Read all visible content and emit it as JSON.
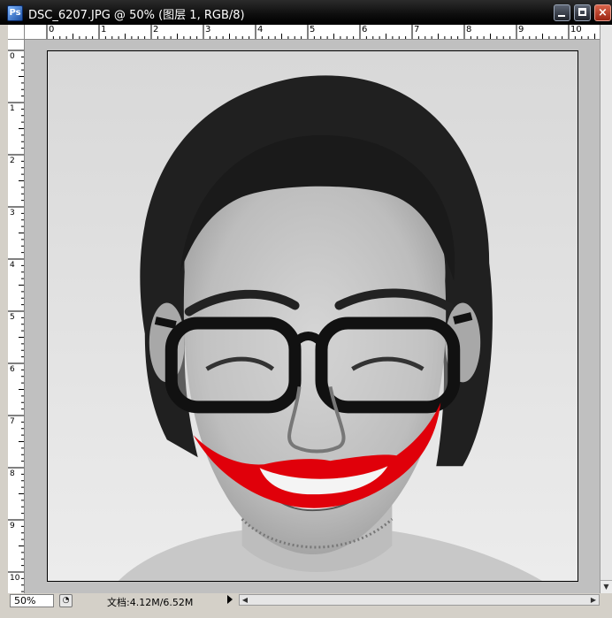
{
  "window": {
    "title": "DSC_6207.JPG @ 50% (图层 1, RGB/8)",
    "controls": {
      "minimize": "minimize",
      "maximize": "maximize",
      "close": "×"
    }
  },
  "rulers": {
    "horizontal_labels": [
      "0",
      "1",
      "2",
      "3",
      "4",
      "5",
      "6",
      "7",
      "8",
      "9",
      "10"
    ],
    "vertical_labels": [
      "0",
      "1",
      "2",
      "3",
      "4",
      "5",
      "6",
      "7",
      "8",
      "9",
      "10"
    ]
  },
  "status": {
    "zoom": "50%",
    "doc_info": "文档:4.12M/6.52M"
  },
  "icons": {
    "app": "photoshop-document-icon",
    "status": "status-navigator-icon"
  },
  "colors": {
    "lipstick": "#e0000a",
    "titlebar": "#111111",
    "background": "#c0c0c0"
  }
}
